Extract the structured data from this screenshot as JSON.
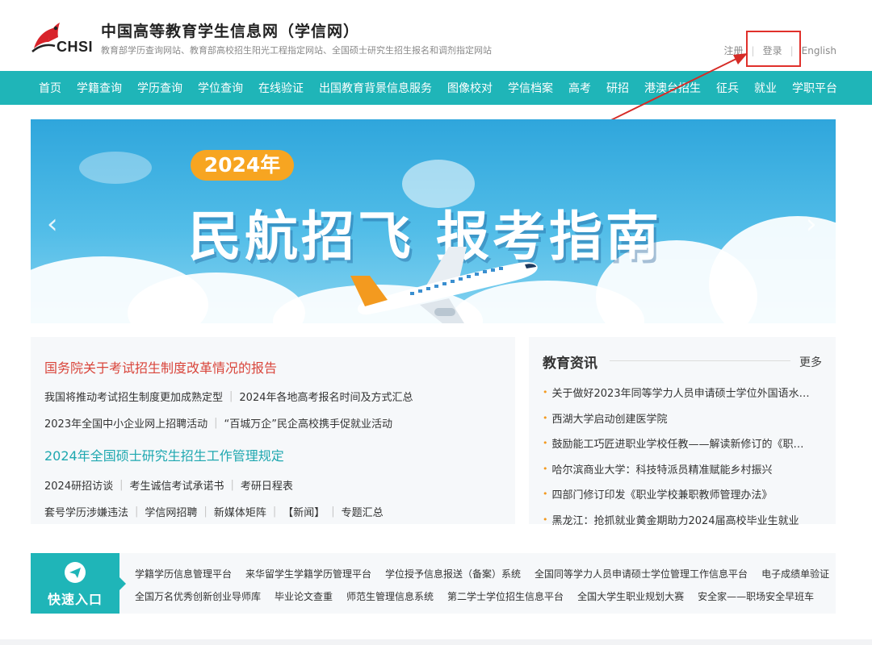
{
  "header": {
    "logo_text": "CHSI",
    "title": "中国高等教育学生信息网（学信网）",
    "subtitle": "教育部学历查询网站、教育部高校招生阳光工程指定网站、全国硕士研究生招生报名和调剂指定网站",
    "register": "注册",
    "login": "登录",
    "english": "English"
  },
  "nav": [
    "首页",
    "学籍查询",
    "学历查询",
    "学位查询",
    "在线验证",
    "出国教育背景信息服务",
    "图像校对",
    "学信档案",
    "高考",
    "研招",
    "港澳台招生",
    "征兵",
    "就业",
    "学职平台"
  ],
  "banner": {
    "year": "2024年",
    "title": "民航招飞 报考指南",
    "prev": "‹",
    "next": "›"
  },
  "news_left": {
    "headline1": "国务院关于考试招生制度改革情况的报告",
    "row1": [
      "我国将推动考试招生制度更加成熟定型",
      "2024年各地高考报名时间及方式汇总"
    ],
    "row2": [
      "2023年全国中小企业网上招聘活动",
      "“百城万企”民企高校携手促就业活动"
    ],
    "headline2": "2024年全国硕士研究生招生工作管理规定",
    "row3": [
      "2024研招访谈",
      "考生诚信考试承诺书",
      "考研日程表"
    ],
    "row4": [
      "套号学历涉嫌违法",
      "学信网招聘",
      "新媒体矩阵",
      "【新闻】",
      "专题汇总"
    ]
  },
  "news_right": {
    "title": "教育资讯",
    "more": "更多",
    "items": [
      "关于做好2023年同等学力人员申请硕士学位外国语水…",
      "西湖大学启动创建医学院",
      "鼓励能工巧匠进职业学校任教——解读新修订的《职…",
      "哈尔滨商业大学：科技特派员精准赋能乡村振兴",
      "四部门修订印发《职业学校兼职教师管理办法》",
      "黑龙江：抢抓就业黄金期助力2024届高校毕业生就业"
    ]
  },
  "quick": {
    "label": "快速入口",
    "row1": [
      "学籍学历信息管理平台",
      "来华留学生学籍学历管理平台",
      "学位授予信息报送（备案）系统",
      "全国同等学力人员申请硕士学位管理工作信息平台",
      "电子成绩单验证"
    ],
    "row2": [
      "全国万名优秀创新创业导师库",
      "毕业论文查重",
      "师范生管理信息系统",
      "第二学士学位招生信息平台",
      "全国大学生职业规划大赛",
      "安全家——职场安全早班车"
    ]
  },
  "colors": {
    "accent": "#1fb5b8",
    "headline_red": "#d9453b",
    "headline_teal": "#1fa8b0",
    "badge_orange": "#f7a521",
    "highlight_red": "#e0302b"
  },
  "icons": [
    "chsi-logo-icon",
    "paper-plane-icon",
    "chevron-left-icon",
    "chevron-right-icon",
    "airplane-illustration"
  ]
}
